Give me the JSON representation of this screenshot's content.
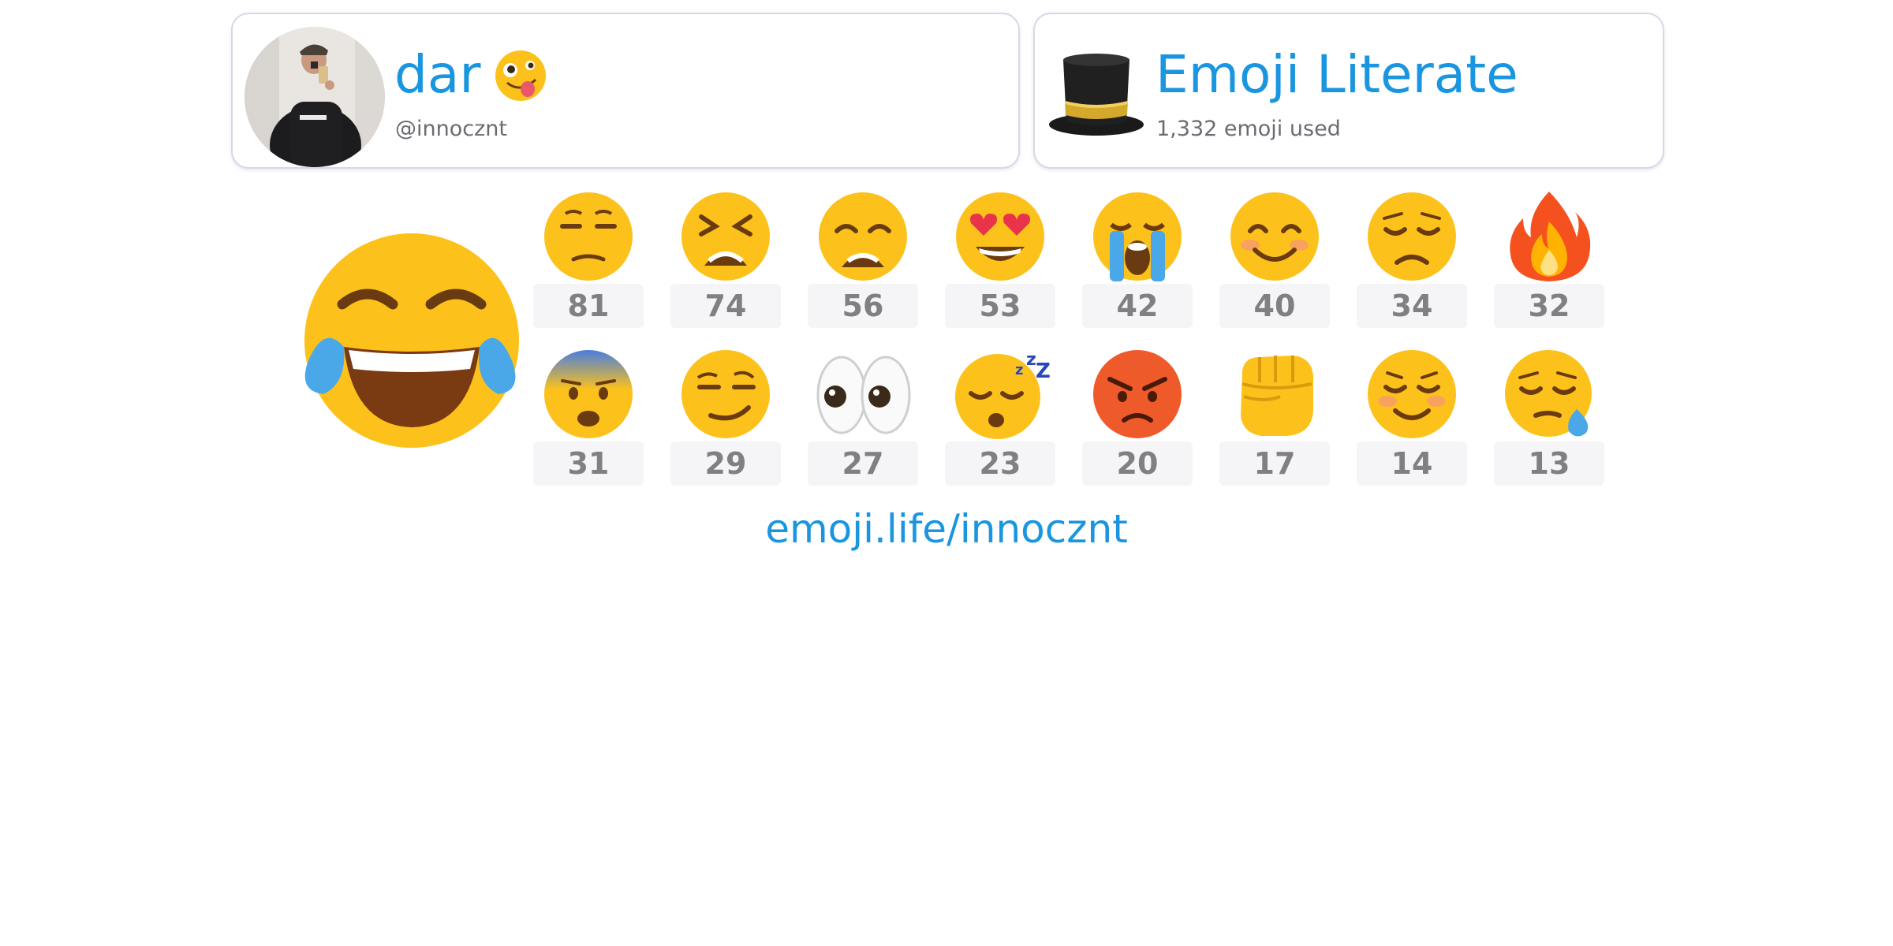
{
  "profile": {
    "name": "dar",
    "handle": "@innocznt",
    "name_emoji": "zany-face-emoji",
    "avatar": "user-avatar-photo"
  },
  "rank": {
    "title": "Emoji Literate",
    "subtitle": "1,332 emoji used",
    "icon": "top-hat-emoji"
  },
  "top_emoji": {
    "name": "face-with-tears-of-joy-emoji"
  },
  "emoji_stats": [
    {
      "name": "unamused-face-emoji",
      "count": "81"
    },
    {
      "name": "tired-face-emoji",
      "count": "74"
    },
    {
      "name": "weary-face-emoji",
      "count": "56"
    },
    {
      "name": "heart-eyes-emoji",
      "count": "53"
    },
    {
      "name": "loudly-crying-face-emoji",
      "count": "42"
    },
    {
      "name": "smiling-face-with-smiling-eyes-emoji",
      "count": "40"
    },
    {
      "name": "disappointed-face-emoji",
      "count": "34"
    },
    {
      "name": "fire-emoji",
      "count": "32"
    },
    {
      "name": "anxious-face-with-sweat-emoji",
      "count": "31"
    },
    {
      "name": "smirking-face-emoji",
      "count": "29"
    },
    {
      "name": "eyes-emoji",
      "count": "27"
    },
    {
      "name": "sleeping-face-emoji",
      "count": "23"
    },
    {
      "name": "pouting-face-emoji",
      "count": "20"
    },
    {
      "name": "oncoming-fist-emoji",
      "count": "17"
    },
    {
      "name": "smiling-face-emoji",
      "count": "14"
    },
    {
      "name": "sleepy-face-emoji",
      "count": "13"
    }
  ],
  "footer": {
    "link": "emoji.life/innocznt"
  },
  "colors": {
    "accent": "#1a96e0",
    "muted_text": "#6b6b73",
    "count_text": "#7f7f84",
    "count_bg": "#f5f5f7",
    "card_border": "#d4d9e8",
    "emoji_yellow": "#fcc21b"
  }
}
